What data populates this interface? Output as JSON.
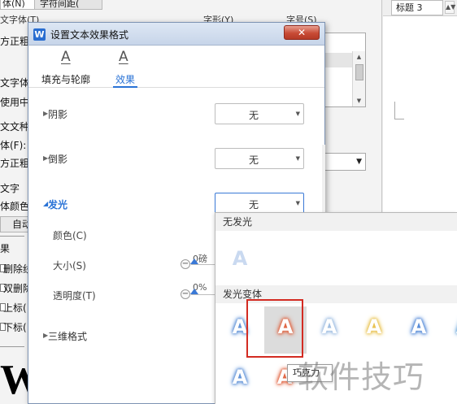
{
  "background_dialog": {
    "tab_left": "体(N)",
    "tab_right": "字符间距(",
    "col_labels": [
      "文字体(T)",
      "字形(Y)",
      "字号(S)"
    ],
    "left_labels": [
      "文字体",
      "方正粗黑",
      "文字体",
      "使用中",
      "文文种",
      "体(F):",
      "方正粗黑",
      "文字",
      "体颜色",
      "果",
      "删除线",
      "双删除",
      "上标(",
      "下标("
    ],
    "auto_button": "自动",
    "big_letter": "W"
  },
  "toolbar": {
    "style_name": "标题 3"
  },
  "dialog": {
    "title": "设置文本效果格式",
    "close_label": "✕",
    "tabs": [
      {
        "icon": "A",
        "label": "填充与轮廓",
        "active": false
      },
      {
        "icon": "A",
        "label": "效果",
        "active": true
      }
    ],
    "sections": {
      "shadow": {
        "label": "阴影",
        "value": "无"
      },
      "reflection": {
        "label": "倒影",
        "value": "无"
      },
      "glow": {
        "label": "发光",
        "value": "无",
        "expanded": true
      },
      "color_label": "颜色(C)",
      "size": {
        "label": "大小(S)",
        "value": "0磅"
      },
      "transparency": {
        "label": "透明度(T)",
        "value": "0%"
      },
      "three_d": {
        "label": "三维格式"
      }
    }
  },
  "glow_panel": {
    "no_glow_header": "无发光",
    "variants_header": "发光变体",
    "no_glow_letter": "A",
    "variant_letter": "A",
    "row1_colors": [
      "#5b8fd6",
      "#e0613d",
      "#9bbbe0",
      "#e8c04a",
      "#4f86d6",
      "#6aa6da"
    ],
    "row2_colors": [
      "#5b8fd6",
      "#e0613d"
    ],
    "selected_index": 1,
    "tooltip": "巧克力"
  },
  "watermark": "软件技巧",
  "colors": {
    "accent": "#2a73d6",
    "highlight_border": "#d32b22",
    "close_button": "#c84b36"
  }
}
